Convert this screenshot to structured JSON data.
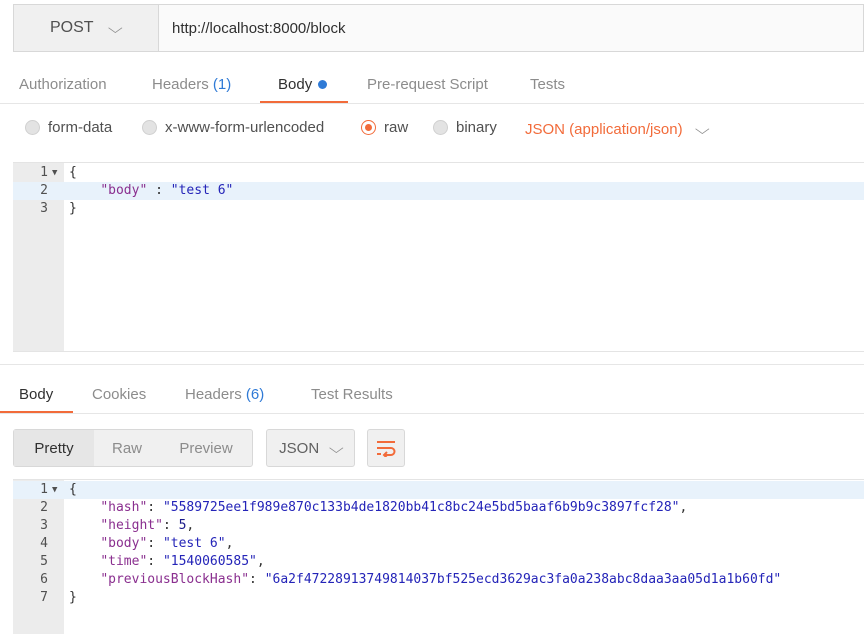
{
  "request": {
    "method": "POST",
    "url": "http://localhost:8000/block"
  },
  "request_tabs": [
    {
      "label": "Authorization"
    },
    {
      "label": "Headers",
      "count": "(1)"
    },
    {
      "label": "Body",
      "active": true
    },
    {
      "label": "Pre-request Script"
    },
    {
      "label": "Tests"
    }
  ],
  "body_options": [
    {
      "label": "form-data",
      "selected": false
    },
    {
      "label": "x-www-form-urlencoded",
      "selected": false
    },
    {
      "label": "raw",
      "selected": true
    },
    {
      "label": "binary",
      "selected": false
    }
  ],
  "content_type": "JSON (application/json)",
  "request_editor": {
    "lines": [
      {
        "num": "1",
        "text": "{"
      },
      {
        "num": "2",
        "key": "\"body\"",
        "sep": " : ",
        "value": "\"test 6\""
      },
      {
        "num": "3",
        "text": "}"
      }
    ]
  },
  "response_tabs": [
    {
      "label": "Body",
      "active": true
    },
    {
      "label": "Cookies"
    },
    {
      "label": "Headers",
      "count": "(6)"
    },
    {
      "label": "Test Results"
    }
  ],
  "view_modes": [
    {
      "label": "Pretty",
      "active": true
    },
    {
      "label": "Raw"
    },
    {
      "label": "Preview"
    }
  ],
  "format": "JSON",
  "response_editor": {
    "lines": [
      {
        "num": "1",
        "text": "{"
      },
      {
        "num": "2",
        "key": "\"hash\"",
        "value": "\"5589725ee1f989e870c133b4de1820bb41c8bc24e5bd5baaf6b9b9c3897fcf28\"",
        "trail": ","
      },
      {
        "num": "3",
        "key": "\"height\"",
        "value": "5",
        "trail": ","
      },
      {
        "num": "4",
        "key": "\"body\"",
        "value": "\"test 6\"",
        "trail": ","
      },
      {
        "num": "5",
        "key": "\"time\"",
        "value": "\"1540060585\"",
        "trail": ","
      },
      {
        "num": "6",
        "key": "\"previousBlockHash\"",
        "value": "\"6a2f47228913749814037bf525ecd3629ac3fa0a238abc8daa3aa05d1a1b60fd\"",
        "trail": ""
      },
      {
        "num": "7",
        "text": "}"
      }
    ]
  },
  "colors": {
    "accent": "#f26b3a",
    "count_blue": "#2f7ad6"
  },
  "icons": {
    "method_dropdown": "chevron-down-icon",
    "content_type_dropdown": "chevron-down-icon",
    "format_dropdown": "chevron-down-icon",
    "wrap": "wrap-lines-icon",
    "fold": "fold-triangle-icon",
    "active_tab": "unsaved-dot-icon"
  }
}
